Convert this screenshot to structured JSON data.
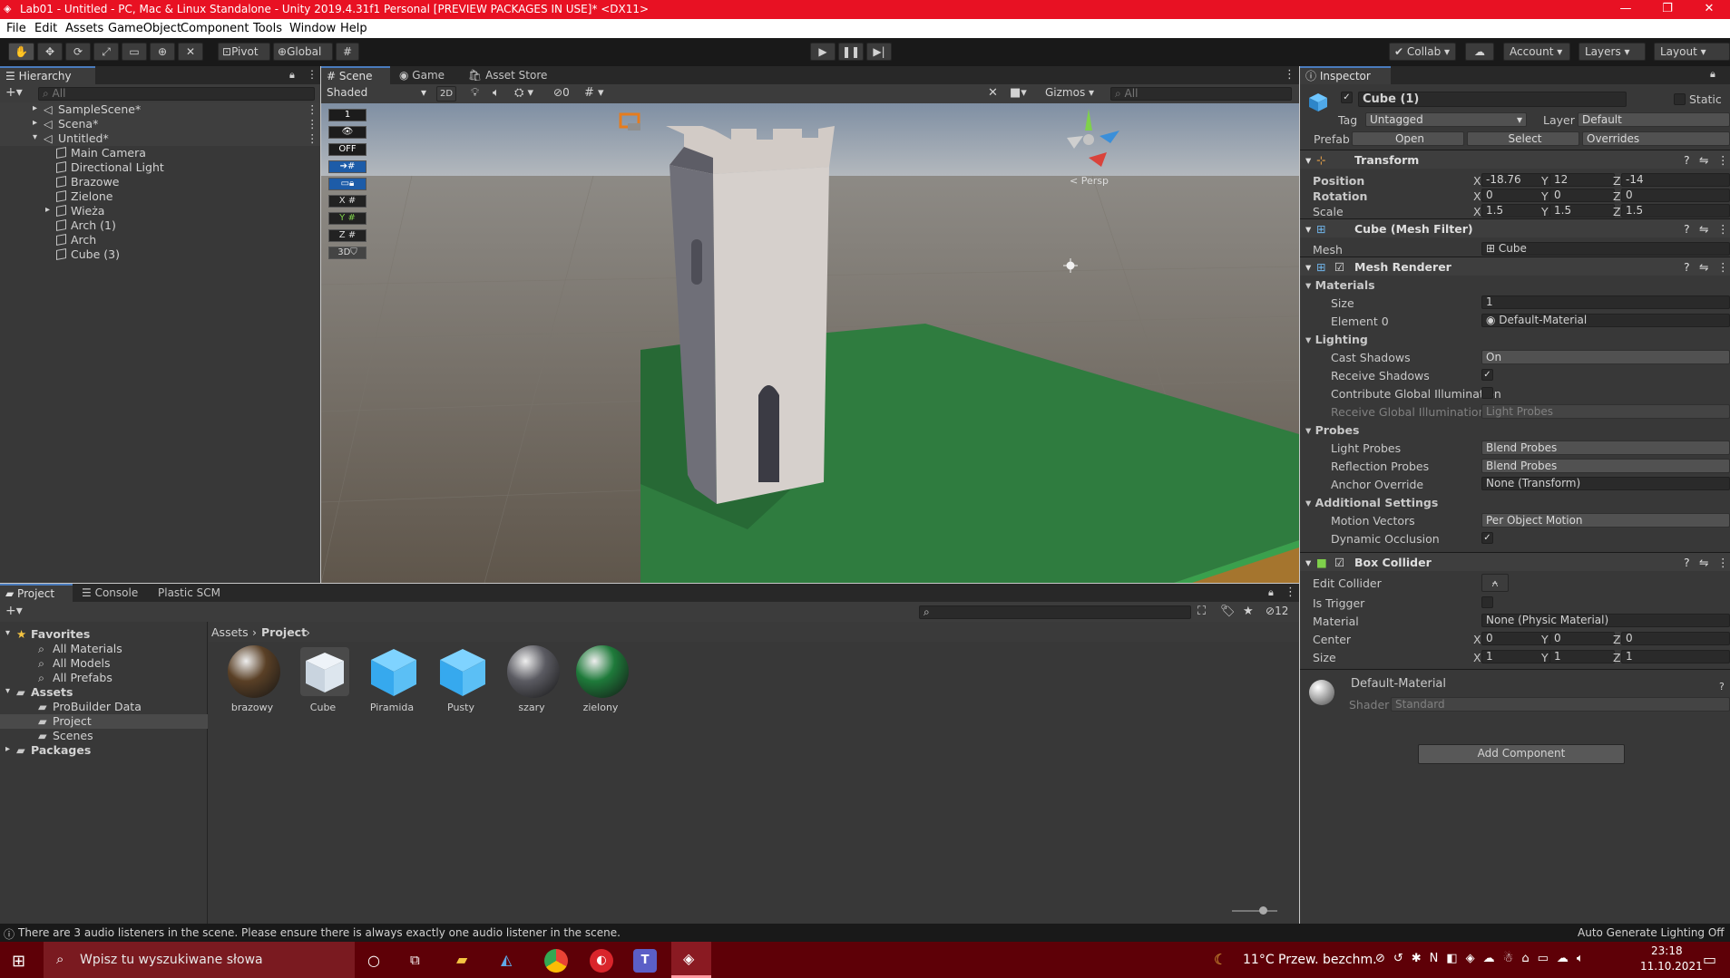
{
  "window": {
    "title": "Lab01 - Untitled - PC, Mac & Linux Standalone - Unity 2019.4.31f1 Personal [PREVIEW PACKAGES IN USE]* <DX11>",
    "controls": [
      "—",
      "❐",
      "✕"
    ]
  },
  "menu": [
    "File",
    "Edit",
    "Assets",
    "GameObject",
    "Component",
    "Tools",
    "Window",
    "Help"
  ],
  "toolbar": {
    "pivot": "Pivot",
    "global": "Global",
    "collab": "Collab",
    "account": "Account",
    "layers": "Layers",
    "layout": "Layout"
  },
  "hierarchy": {
    "tab": "Hierarchy",
    "search_placeholder": "All",
    "items": [
      {
        "label": "SampleScene*",
        "indent": 0,
        "scene": true
      },
      {
        "label": "Scena*",
        "indent": 0,
        "scene": true
      },
      {
        "label": "Untitled*",
        "indent": 0,
        "scene": true
      },
      {
        "label": "Main Camera",
        "indent": 1
      },
      {
        "label": "Directional Light",
        "indent": 1
      },
      {
        "label": "Brazowe",
        "indent": 1
      },
      {
        "label": "Zielone",
        "indent": 1
      },
      {
        "label": "Wieża",
        "indent": 1
      },
      {
        "label": "Arch (1)",
        "indent": 1
      },
      {
        "label": "Arch",
        "indent": 1
      },
      {
        "label": "Cube (3)",
        "indent": 1
      }
    ]
  },
  "scene_view": {
    "tabs": [
      "Scene",
      "Game",
      "Asset Store"
    ],
    "shading": "Shaded",
    "mode_2d": "2D",
    "hidden_count": "0",
    "gizmos": "Gizmos",
    "search_placeholder": "All",
    "persp": "< Persp",
    "overlay": [
      "1",
      "OFF",
      "X",
      "Y",
      "Z",
      "3D"
    ]
  },
  "inspector": {
    "tab": "Inspector",
    "object_name": "Cube (1)",
    "static": "Static",
    "tag_label": "Tag",
    "tag": "Untagged",
    "layer_label": "Layer",
    "layer": "Default",
    "prefab_label": "Prefab",
    "prefab_open": "Open",
    "prefab_select": "Select",
    "prefab_overrides": "Overrides",
    "transform": {
      "title": "Transform",
      "position_label": "Position",
      "rotation_label": "Rotation",
      "scale_label": "Scale",
      "position": {
        "x": "-18.76",
        "y": "12",
        "z": "-14"
      },
      "rotation": {
        "x": "0",
        "y": "0",
        "z": "0"
      },
      "scale": {
        "x": "1.5",
        "y": "1.5",
        "z": "1.5"
      }
    },
    "mesh_filter": {
      "title": "Cube (Mesh Filter)",
      "mesh_label": "Mesh",
      "mesh": "Cube"
    },
    "mesh_renderer": {
      "title": "Mesh Renderer",
      "materials_label": "Materials",
      "size_label": "Size",
      "size": "1",
      "element0_label": "Element 0",
      "element0": "Default-Material",
      "lighting_label": "Lighting",
      "cast_shadows_label": "Cast Shadows",
      "cast_shadows": "On",
      "receive_shadows_label": "Receive Shadows",
      "contribute_gi_label": "Contribute Global Illumination",
      "receive_gi_label": "Receive Global Illumination",
      "receive_gi": "Light Probes",
      "probes_label": "Probes",
      "light_probes_label": "Light Probes",
      "light_probes": "Blend Probes",
      "reflection_probes_label": "Reflection Probes",
      "reflection_probes": "Blend Probes",
      "anchor_override_label": "Anchor Override",
      "anchor_override": "None (Transform)",
      "additional_label": "Additional Settings",
      "motion_vectors_label": "Motion Vectors",
      "motion_vectors": "Per Object Motion",
      "dynamic_occlusion_label": "Dynamic Occlusion"
    },
    "box_collider": {
      "title": "Box Collider",
      "edit_collider_label": "Edit Collider",
      "is_trigger_label": "Is Trigger",
      "material_label": "Material",
      "material": "None (Physic Material)",
      "center_label": "Center",
      "size_label": "Size",
      "center": {
        "x": "0",
        "y": "0",
        "z": "0"
      },
      "size": {
        "x": "1",
        "y": "1",
        "z": "1"
      }
    },
    "material_preview": {
      "name": "Default-Material",
      "shader_label": "Shader",
      "shader": "Standard"
    },
    "add_component": "Add Component"
  },
  "project": {
    "tabs": [
      "Project",
      "Console",
      "Plastic SCM"
    ],
    "hidden_count": "12",
    "tree": [
      {
        "label": "Favorites",
        "indent": 0,
        "bold": true,
        "icon": "star"
      },
      {
        "label": "All Materials",
        "indent": 1,
        "icon": "search"
      },
      {
        "label": "All Models",
        "indent": 1,
        "icon": "search"
      },
      {
        "label": "All Prefabs",
        "indent": 1,
        "icon": "search"
      },
      {
        "label": "Assets",
        "indent": 0,
        "bold": true,
        "icon": "folder"
      },
      {
        "label": "ProBuilder Data",
        "indent": 1,
        "icon": "folder"
      },
      {
        "label": "Project",
        "indent": 1,
        "icon": "folder",
        "selected": true
      },
      {
        "label": "Scenes",
        "indent": 1,
        "icon": "folder"
      },
      {
        "label": "Packages",
        "indent": 0,
        "bold": true,
        "icon": "folder"
      }
    ],
    "breadcrumb": [
      "Assets",
      "Project"
    ],
    "assets": [
      {
        "label": "brazowy",
        "kind": "sphere",
        "color": "#5a4026"
      },
      {
        "label": "Cube",
        "kind": "mesh"
      },
      {
        "label": "Piramida",
        "kind": "prefab"
      },
      {
        "label": "Pusty",
        "kind": "prefab"
      },
      {
        "label": "szary",
        "kind": "sphere",
        "color": "#5b5b62"
      },
      {
        "label": "zielony",
        "kind": "sphere",
        "color": "#1e7a3a"
      }
    ]
  },
  "status_bar": {
    "message": "There are 3 audio listeners in the scene. Please ensure there is always exactly one audio listener in the scene.",
    "right": "Auto Generate Lighting Off"
  },
  "taskbar": {
    "search_placeholder": "Wpisz tu wyszukiwane słowa",
    "weather": "11°C  Przew. bezchm.",
    "time": "23:18",
    "date": "11.10.2021"
  },
  "colors": {
    "title_bar": "#e81123",
    "taskbar": "#5e0007",
    "panel": "#383838",
    "accent": "#4a7bbd"
  }
}
